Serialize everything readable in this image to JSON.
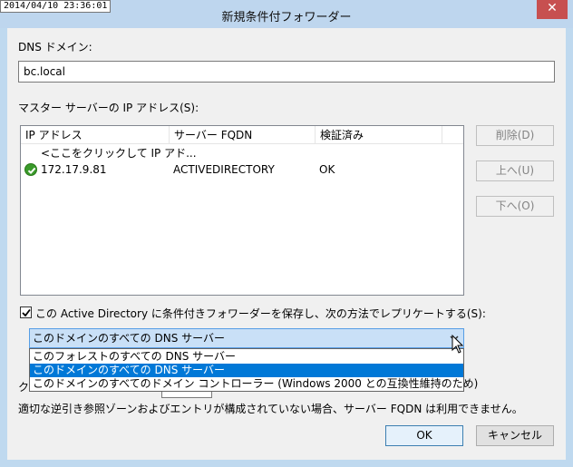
{
  "timestamp": "2014/04/10 23:36:01",
  "title": "新規条件付フォワーダー",
  "close_glyph": "✕",
  "dns_domain": {
    "label": "DNS ドメイン:",
    "value": "bc.local"
  },
  "master_servers": {
    "label": "マスター サーバーの IP アドレス(S):",
    "columns": [
      "IP アドレス",
      "サーバー FQDN",
      "検証済み"
    ],
    "add_row_placeholder": "<ここをクリックして IP アド...",
    "rows": [
      {
        "ip": "172.17.9.81",
        "fqdn": "ACTIVEDIRECTORY",
        "validated": "OK",
        "icon": "ok-check-icon"
      }
    ]
  },
  "side_buttons": {
    "delete": "削除(D)",
    "up": "上へ(U)",
    "down": "下へ(O)"
  },
  "replicate": {
    "checkbox_label": "この Active Directory に条件付きフォワーダーを保存し、次の方法でレプリケートする(S):",
    "checked": true,
    "selected_value": "このドメインのすべての DNS サーバー",
    "options": [
      "このフォレストのすべての DNS サーバー",
      "このドメインのすべての DNS サーバー",
      "このドメインのすべてのドメイン コントローラー (Windows 2000 との互換性維持のため)"
    ],
    "selected_index": 1
  },
  "obscured_label_fragment": "ク",
  "note": "適切な逆引き参照ゾーンおよびエントリが構成されていない場合、サーバー FQDN は利用できません。",
  "footer": {
    "ok": "OK",
    "cancel": "キャンセル"
  },
  "colors": {
    "title_bar": "#bed6ee",
    "close_button": "#c75050",
    "selection": "#0078d7",
    "combo_focus": "#c9e0f7"
  }
}
